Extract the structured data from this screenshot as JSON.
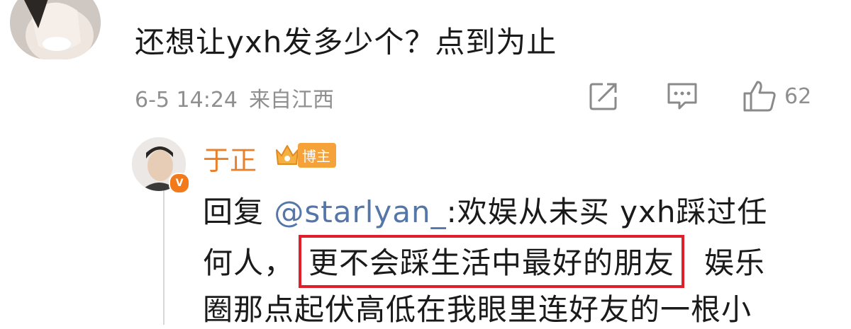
{
  "comment": {
    "text": "还想让yxh发多少个？点到为止",
    "date": "6-5 14:24",
    "location": "来自江西",
    "like_count": "62",
    "icons": [
      "share-icon",
      "comment-icon",
      "like-icon"
    ]
  },
  "reply": {
    "username": "于正",
    "badge_label": "博主",
    "prefix": "回复 ",
    "mention": "@starlyan_",
    "line1_rest": ":欢娱从未买 yxh踩过任",
    "line2_start": "何人，",
    "line2_highlight": "更不会踩生活中最好的朋友",
    "line2_end": "娱乐",
    "line3": "圈那点起伏高低在我眼里连好友的一根小"
  },
  "colors": {
    "highlight_border": "#e11e2b",
    "username": "#e8802c",
    "mention": "#5476a8",
    "verified": "#f27a1a"
  }
}
